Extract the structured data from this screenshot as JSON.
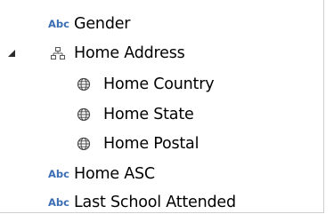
{
  "tree": {
    "items": [
      {
        "label": "Gender",
        "type": "abc",
        "type_text": "Abc",
        "icon": "string-type-icon"
      },
      {
        "label": "Home Address",
        "type": "hierarchy",
        "icon": "hierarchy-icon",
        "expanded": true
      },
      {
        "label": "Home Country",
        "type": "geo",
        "icon": "globe-icon"
      },
      {
        "label": "Home State",
        "type": "geo",
        "icon": "globe-icon"
      },
      {
        "label": "Home Postal",
        "type": "geo",
        "icon": "globe-icon"
      },
      {
        "label": "Home ASC",
        "type": "abc",
        "type_text": "Abc",
        "icon": "string-type-icon"
      },
      {
        "label": "Last School Attended",
        "type": "abc",
        "type_text": "Abc",
        "icon": "string-type-icon"
      }
    ]
  },
  "colors": {
    "type_icon": "#3a6db3",
    "text": "#000000",
    "border": "#cfcfcf",
    "expander": "#2b2b2b"
  }
}
